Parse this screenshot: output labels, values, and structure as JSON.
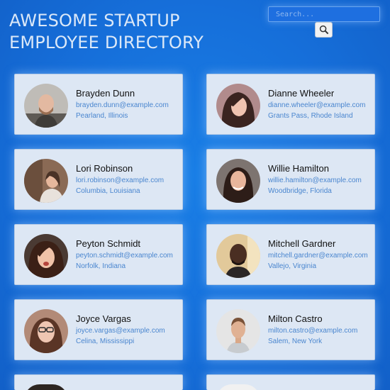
{
  "header": {
    "title": "Awesome Startup Employee Directory"
  },
  "search": {
    "placeholder": "Search...",
    "button_icon": "search-icon"
  },
  "employees": [
    {
      "name": "Brayden Dunn",
      "email": "brayden.dunn@example.com",
      "location": "Pearland, Illinois",
      "avatar_icon": "person-photo-man-bald-beard"
    },
    {
      "name": "Dianne Wheeler",
      "email": "dianne.wheeler@example.com",
      "location": "Grants Pass, Rhode Island",
      "avatar_icon": "person-photo-woman-dark-hair"
    },
    {
      "name": "Lori Robinson",
      "email": "lori.robinson@example.com",
      "location": "Columbia, Louisiana",
      "avatar_icon": "person-photo-woman-indoor"
    },
    {
      "name": "Willie Hamilton",
      "email": "willie.hamilton@example.com",
      "location": "Woodbridge, Florida",
      "avatar_icon": "person-photo-woman-long-dark-hair"
    },
    {
      "name": "Peyton Schmidt",
      "email": "peyton.schmidt@example.com",
      "location": "Norfolk, Indiana",
      "avatar_icon": "person-photo-woman-smiling"
    },
    {
      "name": "Mitchell Gardner",
      "email": "mitchell.gardner@example.com",
      "location": "Vallejo, Virginia",
      "avatar_icon": "person-photo-man-dark-skin"
    },
    {
      "name": "Joyce Vargas",
      "email": "joyce.vargas@example.com",
      "location": "Celina, Mississippi",
      "avatar_icon": "person-photo-woman-glasses"
    },
    {
      "name": "Milton Castro",
      "email": "milton.castro@example.com",
      "location": "Salem, New York",
      "avatar_icon": "person-photo-man-light-background"
    }
  ],
  "partial_cards_below": 2,
  "colors": {
    "background": "#1670dc",
    "card_background": "#dde7f4",
    "title": "#dbe8f8",
    "link_text": "#4a86cf"
  }
}
